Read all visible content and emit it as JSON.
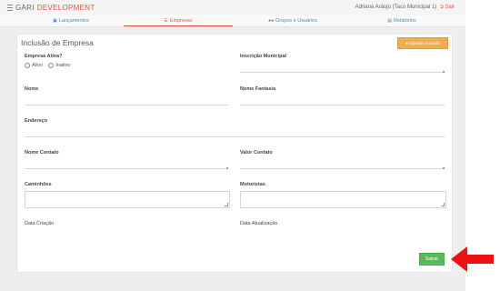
{
  "header": {
    "brand_prefix": "GARI",
    "brand_suffix": "DEVELOPMENT",
    "user_text": "Adriana Aráujo (Taco Municipal 1)",
    "logout_label": "Sair"
  },
  "nav": {
    "tabs": [
      {
        "label": "Lançamentos",
        "icon": "document-icon"
      },
      {
        "label": "Empresas",
        "icon": "list-icon",
        "active": true
      },
      {
        "label": "Grupos e Usuários",
        "icon": "users-icon"
      },
      {
        "label": "Relatórios",
        "icon": "report-icon"
      }
    ]
  },
  "form": {
    "title": "Inclusão de Empresa",
    "help_button": "Dúvidas Inclusão",
    "empresa_ativa_label": "Empresa Ativa?",
    "radio_ativo": "Ativo",
    "radio_inativo": "Inativo",
    "inscricao_label": "Inscrição Municipal",
    "nome_label": "Nome",
    "nome_fantasia_label": "Nome Fantasia",
    "endereco_label": "Endereço",
    "nome_contato_label": "Nome Contato",
    "valor_contato_label": "Valor Contato",
    "caminhoes_label": "Caminhões",
    "motoristas_label": "Motoristas",
    "data_criacao_label": "Data Criação",
    "data_atualizacao_label": "Data Atualização",
    "save_button": "Salvar"
  },
  "colors": {
    "accent_red": "#e0533f",
    "link_blue": "#4a86c8",
    "help_orange": "#f0ad4e",
    "save_green": "#5cb85c",
    "arrow_red": "#ee1111"
  }
}
